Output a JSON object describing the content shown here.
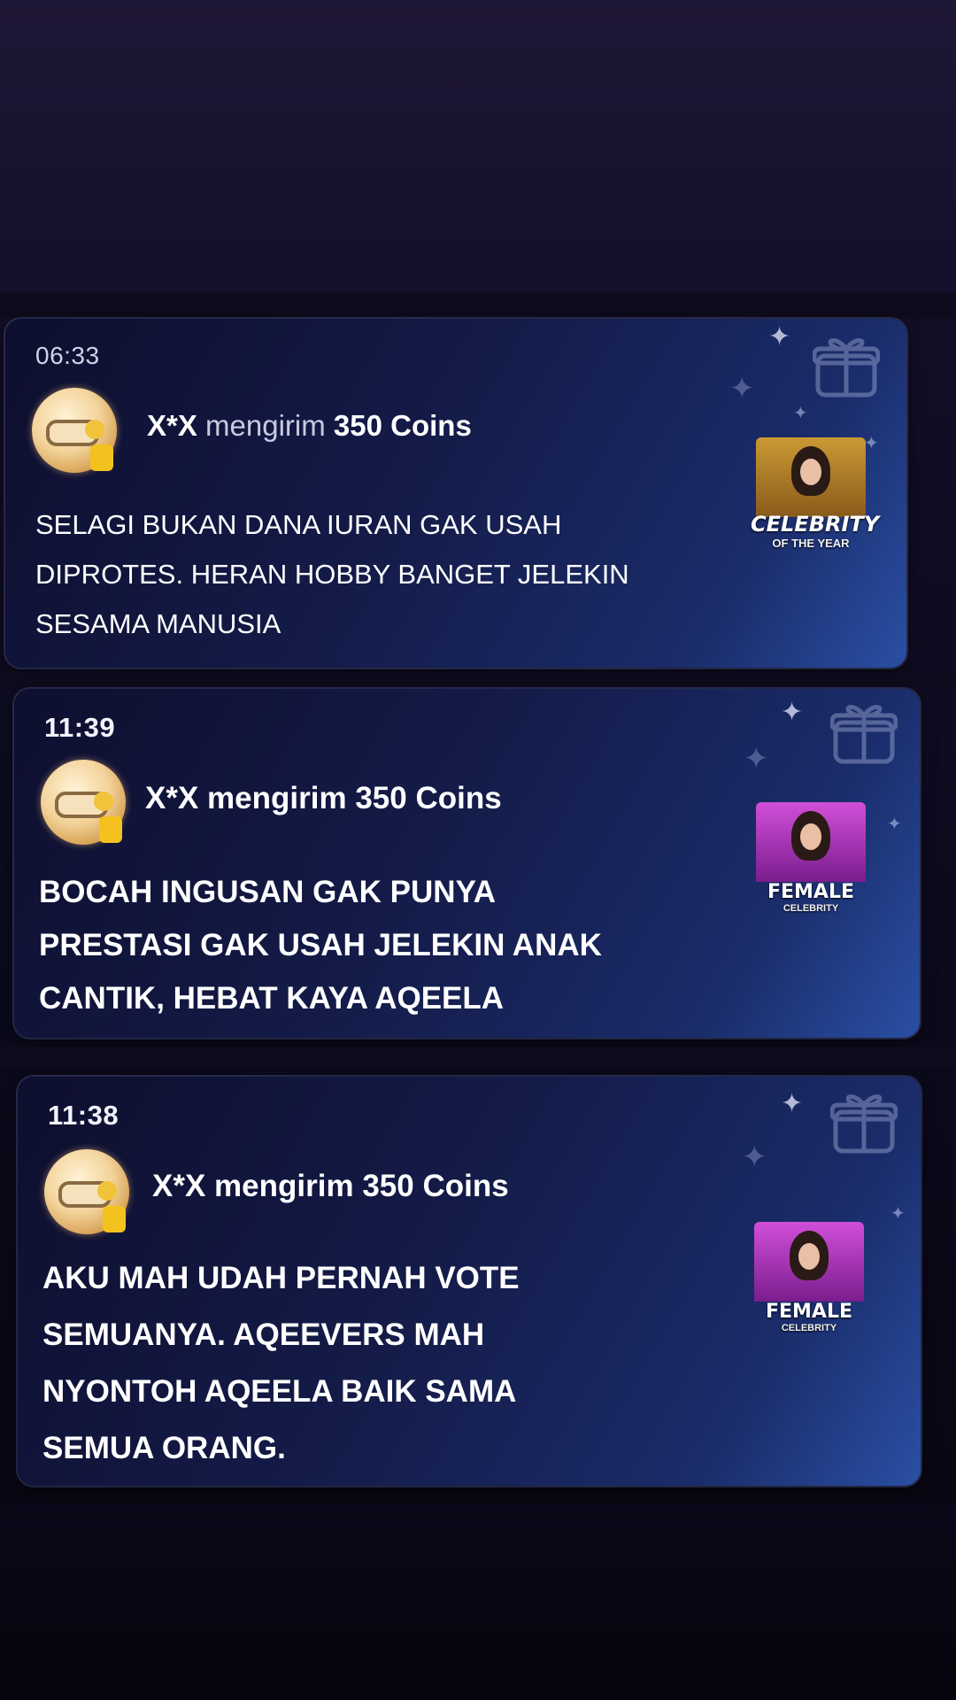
{
  "notifications": [
    {
      "time": "06:33",
      "sender": "X*X",
      "verb": "mengirim",
      "amount": "350 Coins",
      "message_lines": [
        "SELAGI BUKAN DANA IURAN GAK USAH",
        "DIPROTES. HERAN HOBBY BANGET JELEKIN",
        "SESAMA MANUSIA"
      ],
      "award": {
        "title": "CELEBRITY",
        "subtitle": "OF THE YEAR"
      }
    },
    {
      "time": "11:39",
      "sender": "X*X",
      "verb": "mengirim",
      "amount": "350 Coins",
      "message_lines": [
        "BOCAH INGUSAN GAK PUNYA",
        "PRESTASI GAK USAH JELEKIN ANAK",
        "CANTIK, HEBAT KAYA AQEELA"
      ],
      "award": {
        "title": "FEMALE",
        "subtitle": "CELEBRITY"
      }
    },
    {
      "time": "11:38",
      "sender": "X*X",
      "verb": "mengirim",
      "amount": "350 Coins",
      "message_lines": [
        "AKU MAH UDAH PERNAH VOTE",
        "SEMUANYA. AQEEVERS MAH",
        "NYONTOH AQEELA BAIK SAMA",
        "SEMUA ORANG."
      ],
      "award": {
        "title": "FEMALE",
        "subtitle": "CELEBRITY"
      }
    }
  ],
  "icons": {
    "coin": "coin-badge-icon",
    "gift": "gift-box-icon",
    "sparkle": "sparkle-icon"
  },
  "colors": {
    "background": "#0a0818",
    "card_start": "#0e0f2e",
    "card_end": "#2a4fa3",
    "coin": "#f3d39a",
    "award_gold": "#c99a32",
    "award_pink": "#d04fd8"
  }
}
